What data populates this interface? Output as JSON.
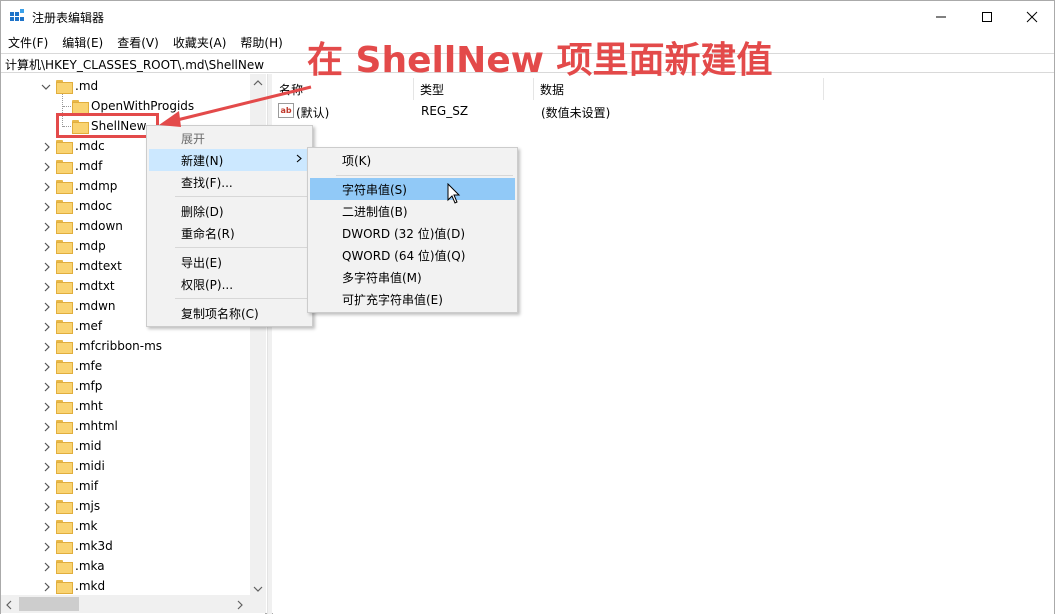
{
  "window": {
    "title": "注册表编辑器"
  },
  "menu": [
    "文件(F)",
    "编辑(E)",
    "查看(V)",
    "收藏夹(A)",
    "帮助(H)"
  ],
  "address": "计算机\\HKEY_CLASSES_ROOT\\.md\\ShellNew",
  "tree": {
    "parent": ".md",
    "children": [
      "OpenWithProgids",
      "ShellNew"
    ],
    "siblings": [
      ".mdc",
      ".mdf",
      ".mdmp",
      ".mdoc",
      ".mdown",
      ".mdp",
      ".mdtext",
      ".mdtxt",
      ".mdwn",
      ".mef",
      ".mfcribbon-ms",
      ".mfe",
      ".mfp",
      ".mht",
      ".mhtml",
      ".mid",
      ".midi",
      ".mif",
      ".mjs",
      ".mk",
      ".mk3d",
      ".mka",
      ".mkd"
    ]
  },
  "list": {
    "headers": [
      "名称",
      "类型",
      "数据"
    ],
    "rows": [
      {
        "name": "(默认)",
        "type": "REG_SZ",
        "data": "(数值未设置)"
      }
    ]
  },
  "context_menu": {
    "items": [
      "展开",
      "新建(N)",
      "查找(F)...",
      "删除(D)",
      "重命名(R)",
      "导出(E)",
      "权限(P)...",
      "复制项名称(C)"
    ]
  },
  "submenu": {
    "items": [
      "项(K)",
      "字符串值(S)",
      "二进制值(B)",
      "DWORD (32 位)值(D)",
      "QWORD (64 位)值(Q)",
      "多字符串值(M)",
      "可扩充字符串值(E)"
    ]
  },
  "annotation": "在 ShellNew 项里面新建值",
  "colors": {
    "annotation": "#e34a4a",
    "menu_highlight": "#91c9f7",
    "folder": "#f9d371"
  }
}
